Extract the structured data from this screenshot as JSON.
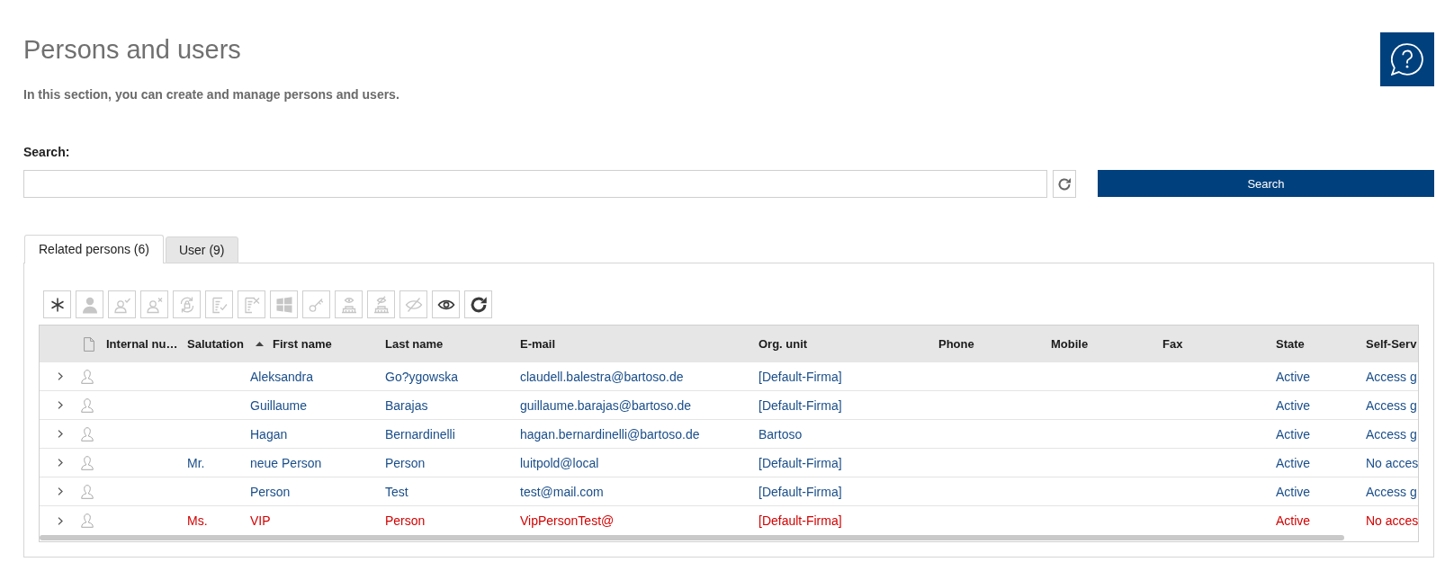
{
  "page": {
    "title": "Persons and users",
    "description": "In this section, you can create and manage persons and users."
  },
  "search": {
    "label": "Search:",
    "button": "Search"
  },
  "tabs": [
    {
      "label": "Related persons (6)",
      "selected": true
    },
    {
      "label": "User (9)",
      "selected": false
    }
  ],
  "toolbar": {
    "buttons": [
      {
        "kind": "new",
        "disabled": false
      },
      {
        "kind": "profile",
        "disabled": true
      },
      {
        "kind": "activate",
        "disabled": true
      },
      {
        "kind": "deactivate",
        "disabled": true
      },
      {
        "kind": "unlock",
        "disabled": true
      },
      {
        "kind": "approve",
        "disabled": true
      },
      {
        "kind": "reject",
        "disabled": true
      },
      {
        "kind": "windows",
        "disabled": true
      },
      {
        "kind": "password",
        "disabled": true
      },
      {
        "kind": "publish",
        "disabled": true
      },
      {
        "kind": "unpublish",
        "disabled": true
      },
      {
        "kind": "hide",
        "disabled": true
      },
      {
        "kind": "show",
        "disabled": false
      },
      {
        "kind": "refresh",
        "disabled": false
      }
    ]
  },
  "table": {
    "columns": [
      {
        "label": "Internal nu…",
        "sorted": false
      },
      {
        "label": "Salutation",
        "sorted": false
      },
      {
        "label": "First name",
        "sorted": true
      },
      {
        "label": "Last name",
        "sorted": false
      },
      {
        "label": "E-mail",
        "sorted": false
      },
      {
        "label": "Org. unit",
        "sorted": false
      },
      {
        "label": "Phone",
        "sorted": false
      },
      {
        "label": "Mobile",
        "sorted": false
      },
      {
        "label": "Fax",
        "sorted": false
      },
      {
        "label": "State",
        "sorted": false
      },
      {
        "label": "Self-Serv",
        "sorted": false
      }
    ],
    "rows": [
      {
        "expanded": false,
        "color": "#1a4e8a",
        "first_name": "Aleksandra",
        "last_name": "Go?ygowska",
        "email": "claudell.balestra@bartoso.de",
        "org_unit": "[Default-Firma]",
        "state": "Active",
        "self_serv": "Access g"
      },
      {
        "expanded": false,
        "color": "#1a4e8a",
        "first_name": "Guillaume",
        "last_name": "Barajas",
        "email": "guillaume.barajas@bartoso.de",
        "org_unit": "[Default-Firma]",
        "state": "Active",
        "self_serv": "Access g"
      },
      {
        "expanded": false,
        "color": "#1a4e8a",
        "first_name": "Hagan",
        "last_name": "Bernardinelli",
        "email": "hagan.bernardinelli@bartoso.de",
        "org_unit": "Bartoso",
        "state": "Active",
        "self_serv": "Access g"
      },
      {
        "expanded": false,
        "color": "#1a4e8a",
        "salutation": "Mr.",
        "first_name": "neue Person",
        "last_name": "Person",
        "email": "luitpold@local",
        "org_unit": "[Default-Firma]",
        "state": "Active",
        "self_serv": "No acces"
      },
      {
        "expanded": false,
        "color": "#1a4e8a",
        "first_name": "Person",
        "last_name": "Test",
        "email": "test@mail.com",
        "org_unit": "[Default-Firma]",
        "state": "Active",
        "self_serv": "Access g"
      },
      {
        "expanded": false,
        "color": "#d40000",
        "salutation": "Ms.",
        "first_name": "VIP",
        "last_name": "Person",
        "email": "VipPersonTest@",
        "org_unit": "[Default-Firma]",
        "state": "Active",
        "self_serv": "No acces"
      }
    ]
  }
}
